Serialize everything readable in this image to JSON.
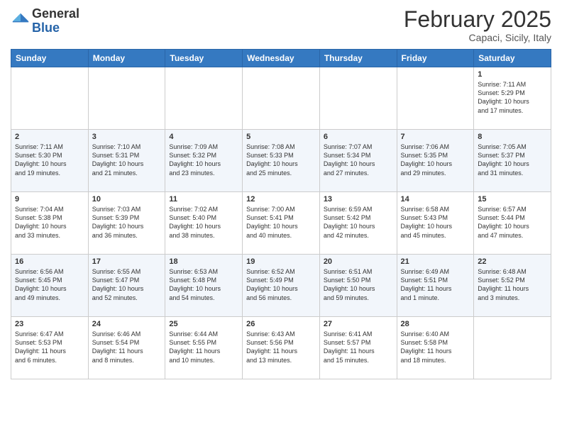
{
  "logo": {
    "general": "General",
    "blue": "Blue"
  },
  "header": {
    "month": "February 2025",
    "location": "Capaci, Sicily, Italy"
  },
  "weekdays": [
    "Sunday",
    "Monday",
    "Tuesday",
    "Wednesday",
    "Thursday",
    "Friday",
    "Saturday"
  ],
  "weeks": [
    [
      {
        "day": "",
        "info": ""
      },
      {
        "day": "",
        "info": ""
      },
      {
        "day": "",
        "info": ""
      },
      {
        "day": "",
        "info": ""
      },
      {
        "day": "",
        "info": ""
      },
      {
        "day": "",
        "info": ""
      },
      {
        "day": "1",
        "info": "Sunrise: 7:11 AM\nSunset: 5:29 PM\nDaylight: 10 hours\nand 17 minutes."
      }
    ],
    [
      {
        "day": "2",
        "info": "Sunrise: 7:11 AM\nSunset: 5:30 PM\nDaylight: 10 hours\nand 19 minutes."
      },
      {
        "day": "3",
        "info": "Sunrise: 7:10 AM\nSunset: 5:31 PM\nDaylight: 10 hours\nand 21 minutes."
      },
      {
        "day": "4",
        "info": "Sunrise: 7:09 AM\nSunset: 5:32 PM\nDaylight: 10 hours\nand 23 minutes."
      },
      {
        "day": "5",
        "info": "Sunrise: 7:08 AM\nSunset: 5:33 PM\nDaylight: 10 hours\nand 25 minutes."
      },
      {
        "day": "6",
        "info": "Sunrise: 7:07 AM\nSunset: 5:34 PM\nDaylight: 10 hours\nand 27 minutes."
      },
      {
        "day": "7",
        "info": "Sunrise: 7:06 AM\nSunset: 5:35 PM\nDaylight: 10 hours\nand 29 minutes."
      },
      {
        "day": "8",
        "info": "Sunrise: 7:05 AM\nSunset: 5:37 PM\nDaylight: 10 hours\nand 31 minutes."
      }
    ],
    [
      {
        "day": "9",
        "info": "Sunrise: 7:04 AM\nSunset: 5:38 PM\nDaylight: 10 hours\nand 33 minutes."
      },
      {
        "day": "10",
        "info": "Sunrise: 7:03 AM\nSunset: 5:39 PM\nDaylight: 10 hours\nand 36 minutes."
      },
      {
        "day": "11",
        "info": "Sunrise: 7:02 AM\nSunset: 5:40 PM\nDaylight: 10 hours\nand 38 minutes."
      },
      {
        "day": "12",
        "info": "Sunrise: 7:00 AM\nSunset: 5:41 PM\nDaylight: 10 hours\nand 40 minutes."
      },
      {
        "day": "13",
        "info": "Sunrise: 6:59 AM\nSunset: 5:42 PM\nDaylight: 10 hours\nand 42 minutes."
      },
      {
        "day": "14",
        "info": "Sunrise: 6:58 AM\nSunset: 5:43 PM\nDaylight: 10 hours\nand 45 minutes."
      },
      {
        "day": "15",
        "info": "Sunrise: 6:57 AM\nSunset: 5:44 PM\nDaylight: 10 hours\nand 47 minutes."
      }
    ],
    [
      {
        "day": "16",
        "info": "Sunrise: 6:56 AM\nSunset: 5:45 PM\nDaylight: 10 hours\nand 49 minutes."
      },
      {
        "day": "17",
        "info": "Sunrise: 6:55 AM\nSunset: 5:47 PM\nDaylight: 10 hours\nand 52 minutes."
      },
      {
        "day": "18",
        "info": "Sunrise: 6:53 AM\nSunset: 5:48 PM\nDaylight: 10 hours\nand 54 minutes."
      },
      {
        "day": "19",
        "info": "Sunrise: 6:52 AM\nSunset: 5:49 PM\nDaylight: 10 hours\nand 56 minutes."
      },
      {
        "day": "20",
        "info": "Sunrise: 6:51 AM\nSunset: 5:50 PM\nDaylight: 10 hours\nand 59 minutes."
      },
      {
        "day": "21",
        "info": "Sunrise: 6:49 AM\nSunset: 5:51 PM\nDaylight: 11 hours\nand 1 minute."
      },
      {
        "day": "22",
        "info": "Sunrise: 6:48 AM\nSunset: 5:52 PM\nDaylight: 11 hours\nand 3 minutes."
      }
    ],
    [
      {
        "day": "23",
        "info": "Sunrise: 6:47 AM\nSunset: 5:53 PM\nDaylight: 11 hours\nand 6 minutes."
      },
      {
        "day": "24",
        "info": "Sunrise: 6:46 AM\nSunset: 5:54 PM\nDaylight: 11 hours\nand 8 minutes."
      },
      {
        "day": "25",
        "info": "Sunrise: 6:44 AM\nSunset: 5:55 PM\nDaylight: 11 hours\nand 10 minutes."
      },
      {
        "day": "26",
        "info": "Sunrise: 6:43 AM\nSunset: 5:56 PM\nDaylight: 11 hours\nand 13 minutes."
      },
      {
        "day": "27",
        "info": "Sunrise: 6:41 AM\nSunset: 5:57 PM\nDaylight: 11 hours\nand 15 minutes."
      },
      {
        "day": "28",
        "info": "Sunrise: 6:40 AM\nSunset: 5:58 PM\nDaylight: 11 hours\nand 18 minutes."
      },
      {
        "day": "",
        "info": ""
      }
    ]
  ]
}
